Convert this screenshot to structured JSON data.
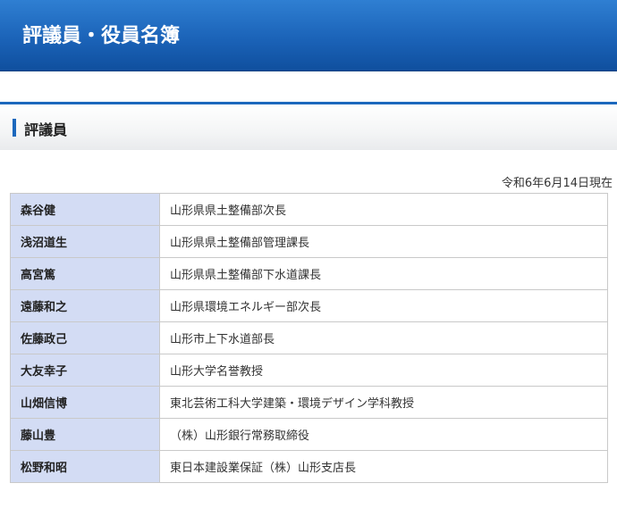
{
  "page": {
    "title": "評議員・役員名簿"
  },
  "section": {
    "title": "評議員",
    "date_note": "令和6年6月14日現在"
  },
  "members": [
    {
      "name": "森谷健",
      "role": "山形県県土整備部次長"
    },
    {
      "name": "浅沼道生",
      "role": "山形県県土整備部管理課長"
    },
    {
      "name": "高宮篤",
      "role": "山形県県土整備部下水道課長"
    },
    {
      "name": "遠藤和之",
      "role": "山形県環境エネルギー部次長"
    },
    {
      "name": "佐藤政己",
      "role": "山形市上下水道部長"
    },
    {
      "name": "大友幸子",
      "role": "山形大学名誉教授"
    },
    {
      "name": "山畑信博",
      "role": "東北芸術工科大学建築・環境デザイン学科教授"
    },
    {
      "name": "藤山豊",
      "role": "（株）山形銀行常務取締役"
    },
    {
      "name": "松野和昭",
      "role": "東日本建設業保証（株）山形支店長"
    }
  ],
  "colors": {
    "banner": "#1b63b8",
    "accent": "#1c68bd",
    "name_cell": "#d3dcf4"
  }
}
